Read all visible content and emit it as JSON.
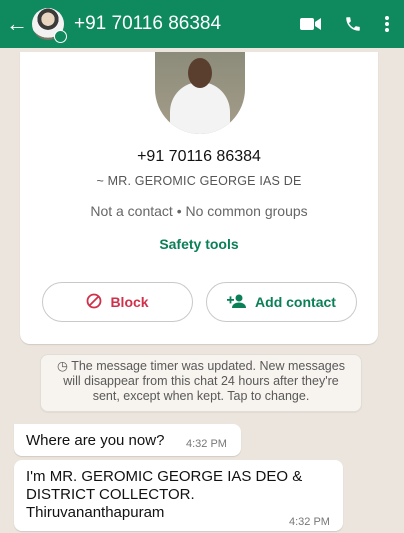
{
  "header": {
    "title": "+91 70116 86384",
    "icons": [
      "back-arrow-icon",
      "video-call-icon",
      "voice-call-icon",
      "more-options-icon"
    ],
    "color": "#0f8a5f"
  },
  "profile": {
    "phone": "+91 70116 86384",
    "push_name": "~ MR. GEROMIC GEORGE IAS  DE",
    "contact_info": "Not a contact • No common groups",
    "safety_tools": "Safety tools",
    "block_label": "Block",
    "add_contact_label": "Add contact"
  },
  "system_message": "The message timer was updated. New messages will disappear from this chat 24 hours after they're sent, except when kept. Tap to change.",
  "messages": [
    {
      "text": "Where are you now?",
      "time": "4:32 PM"
    },
    {
      "text": "I'm MR. GEROMIC GEORGE IAS DEO &\nDISTRICT COLLECTOR.\nThiruvananthapuram",
      "time": "4:32 PM"
    }
  ],
  "colors": {
    "accent_green": "#0b7f56",
    "block_red": "#d0314a",
    "chat_bg": "#ece5dd"
  }
}
